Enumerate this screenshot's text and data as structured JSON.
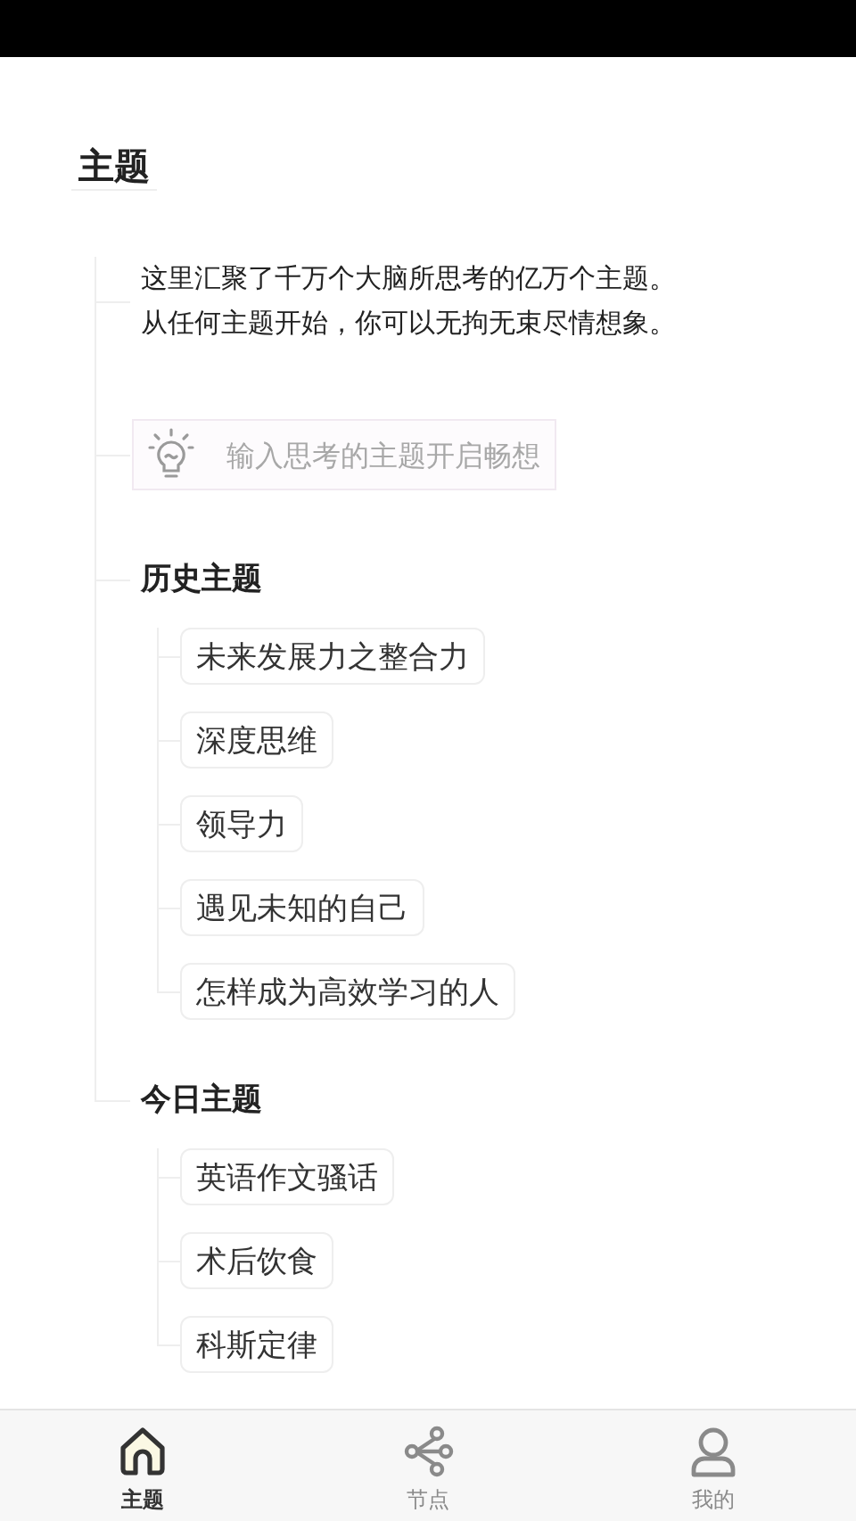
{
  "header": {
    "title": "主题"
  },
  "intro": {
    "lines": [
      "这里汇聚了千万个大脑所思考的亿万个主题。",
      "从任何主题开始，你可以无拘无束尽情想象。"
    ]
  },
  "search": {
    "placeholder": "输入思考的主题开启畅想"
  },
  "sections": [
    {
      "title": "历史主题",
      "topics": [
        "未来发展力之整合力",
        "深度思维",
        "领导力",
        "遇见未知的自己",
        "怎样成为高效学习的人"
      ]
    },
    {
      "title": "今日主题",
      "topics": [
        "英语作文骚话",
        "术后饮食",
        "科斯定律"
      ]
    }
  ],
  "tab_bar": [
    {
      "label": "主题",
      "kind": "home",
      "selected": true
    },
    {
      "label": "节点",
      "kind": "share",
      "selected": false
    },
    {
      "label": "我的",
      "kind": "person",
      "selected": false
    }
  ]
}
